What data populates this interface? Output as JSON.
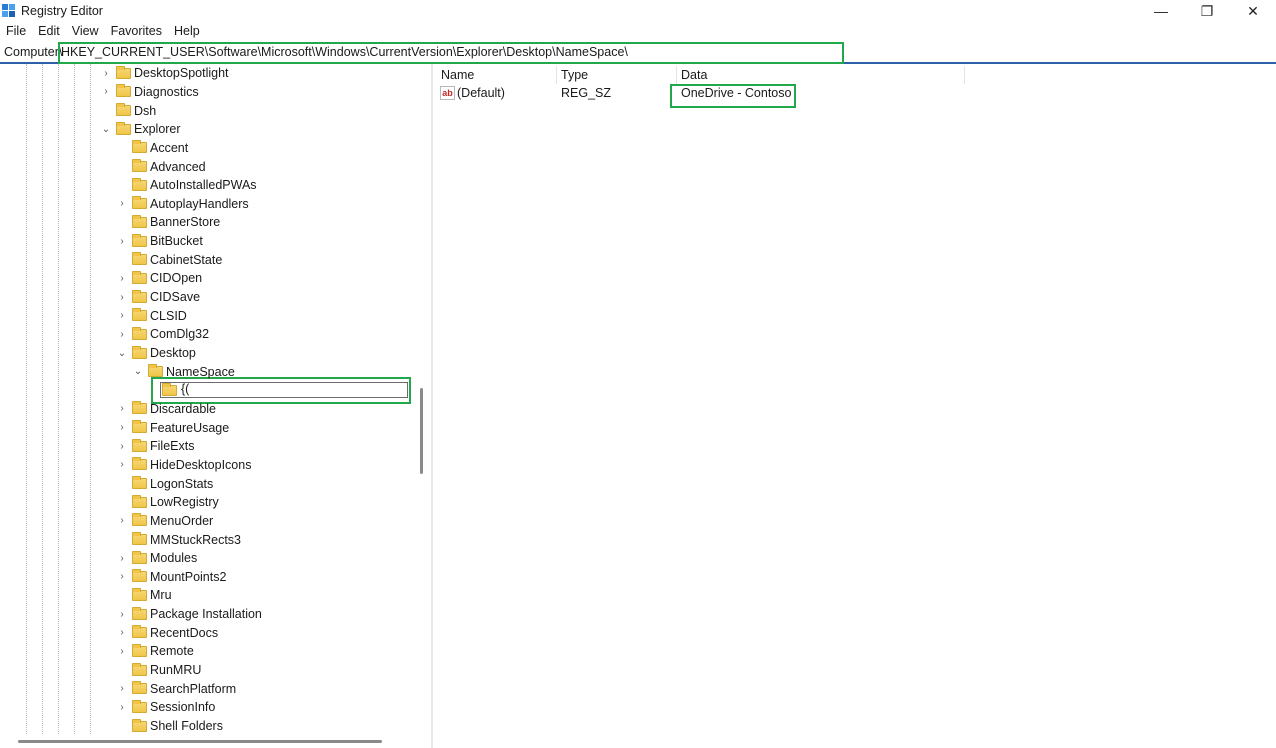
{
  "window": {
    "title": "Registry Editor",
    "controls": {
      "minimize": "—",
      "maximize": "❐",
      "close": "✕"
    }
  },
  "menu": [
    "File",
    "Edit",
    "View",
    "Favorites",
    "Help"
  ],
  "address": {
    "root": "Computer\\",
    "path": "HKEY_CURRENT_USER\\Software\\Microsoft\\Windows\\CurrentVersion\\Explorer\\Desktop\\NameSpace\\"
  },
  "tree": {
    "items": [
      {
        "label": "DesktopSpotlight",
        "depth": 0,
        "chevron": "›"
      },
      {
        "label": "Diagnostics",
        "depth": 0,
        "chevron": "›"
      },
      {
        "label": "Dsh",
        "depth": 0,
        "chevron": ""
      },
      {
        "label": "Explorer",
        "depth": 0,
        "chevron": "⌄"
      },
      {
        "label": "Accent",
        "depth": 1,
        "chevron": ""
      },
      {
        "label": "Advanced",
        "depth": 1,
        "chevron": ""
      },
      {
        "label": "AutoInstalledPWAs",
        "depth": 1,
        "chevron": ""
      },
      {
        "label": "AutoplayHandlers",
        "depth": 1,
        "chevron": "›"
      },
      {
        "label": "BannerStore",
        "depth": 1,
        "chevron": ""
      },
      {
        "label": "BitBucket",
        "depth": 1,
        "chevron": "›"
      },
      {
        "label": "CabinetState",
        "depth": 1,
        "chevron": ""
      },
      {
        "label": "CIDOpen",
        "depth": 1,
        "chevron": "›"
      },
      {
        "label": "CIDSave",
        "depth": 1,
        "chevron": "›"
      },
      {
        "label": "CLSID",
        "depth": 1,
        "chevron": "›"
      },
      {
        "label": "ComDlg32",
        "depth": 1,
        "chevron": "›"
      },
      {
        "label": "Desktop",
        "depth": 1,
        "chevron": "⌄"
      },
      {
        "label": "NameSpace",
        "depth": 2,
        "chevron": "⌄"
      },
      {
        "label": "",
        "depth": 3,
        "chevron": ""
      },
      {
        "label": "Discardable",
        "depth": 1,
        "chevron": "›"
      },
      {
        "label": "FeatureUsage",
        "depth": 1,
        "chevron": "›"
      },
      {
        "label": "FileExts",
        "depth": 1,
        "chevron": "›"
      },
      {
        "label": "HideDesktopIcons",
        "depth": 1,
        "chevron": "›"
      },
      {
        "label": "LogonStats",
        "depth": 1,
        "chevron": ""
      },
      {
        "label": "LowRegistry",
        "depth": 1,
        "chevron": ""
      },
      {
        "label": "MenuOrder",
        "depth": 1,
        "chevron": "›"
      },
      {
        "label": "MMStuckRects3",
        "depth": 1,
        "chevron": ""
      },
      {
        "label": "Modules",
        "depth": 1,
        "chevron": "›"
      },
      {
        "label": "MountPoints2",
        "depth": 1,
        "chevron": "›"
      },
      {
        "label": "Mru",
        "depth": 1,
        "chevron": ""
      },
      {
        "label": "Package Installation",
        "depth": 1,
        "chevron": "›"
      },
      {
        "label": "RecentDocs",
        "depth": 1,
        "chevron": "›"
      },
      {
        "label": "Remote",
        "depth": 1,
        "chevron": "›"
      },
      {
        "label": "RunMRU",
        "depth": 1,
        "chevron": ""
      },
      {
        "label": "SearchPlatform",
        "depth": 1,
        "chevron": "›"
      },
      {
        "label": "SessionInfo",
        "depth": 1,
        "chevron": "›"
      },
      {
        "label": "Shell Folders",
        "depth": 1,
        "chevron": ""
      }
    ],
    "rename_value": "{("
  },
  "values": {
    "headers": {
      "name": "Name",
      "type": "Type",
      "data": "Data"
    },
    "rows": [
      {
        "name": "(Default)",
        "type": "REG_SZ",
        "data": "OneDrive - Contoso",
        "icon": "ab"
      }
    ]
  },
  "colors": {
    "highlight": "#22a84a",
    "address_underline": "#2f5fa8",
    "folder": "#f0c649"
  }
}
